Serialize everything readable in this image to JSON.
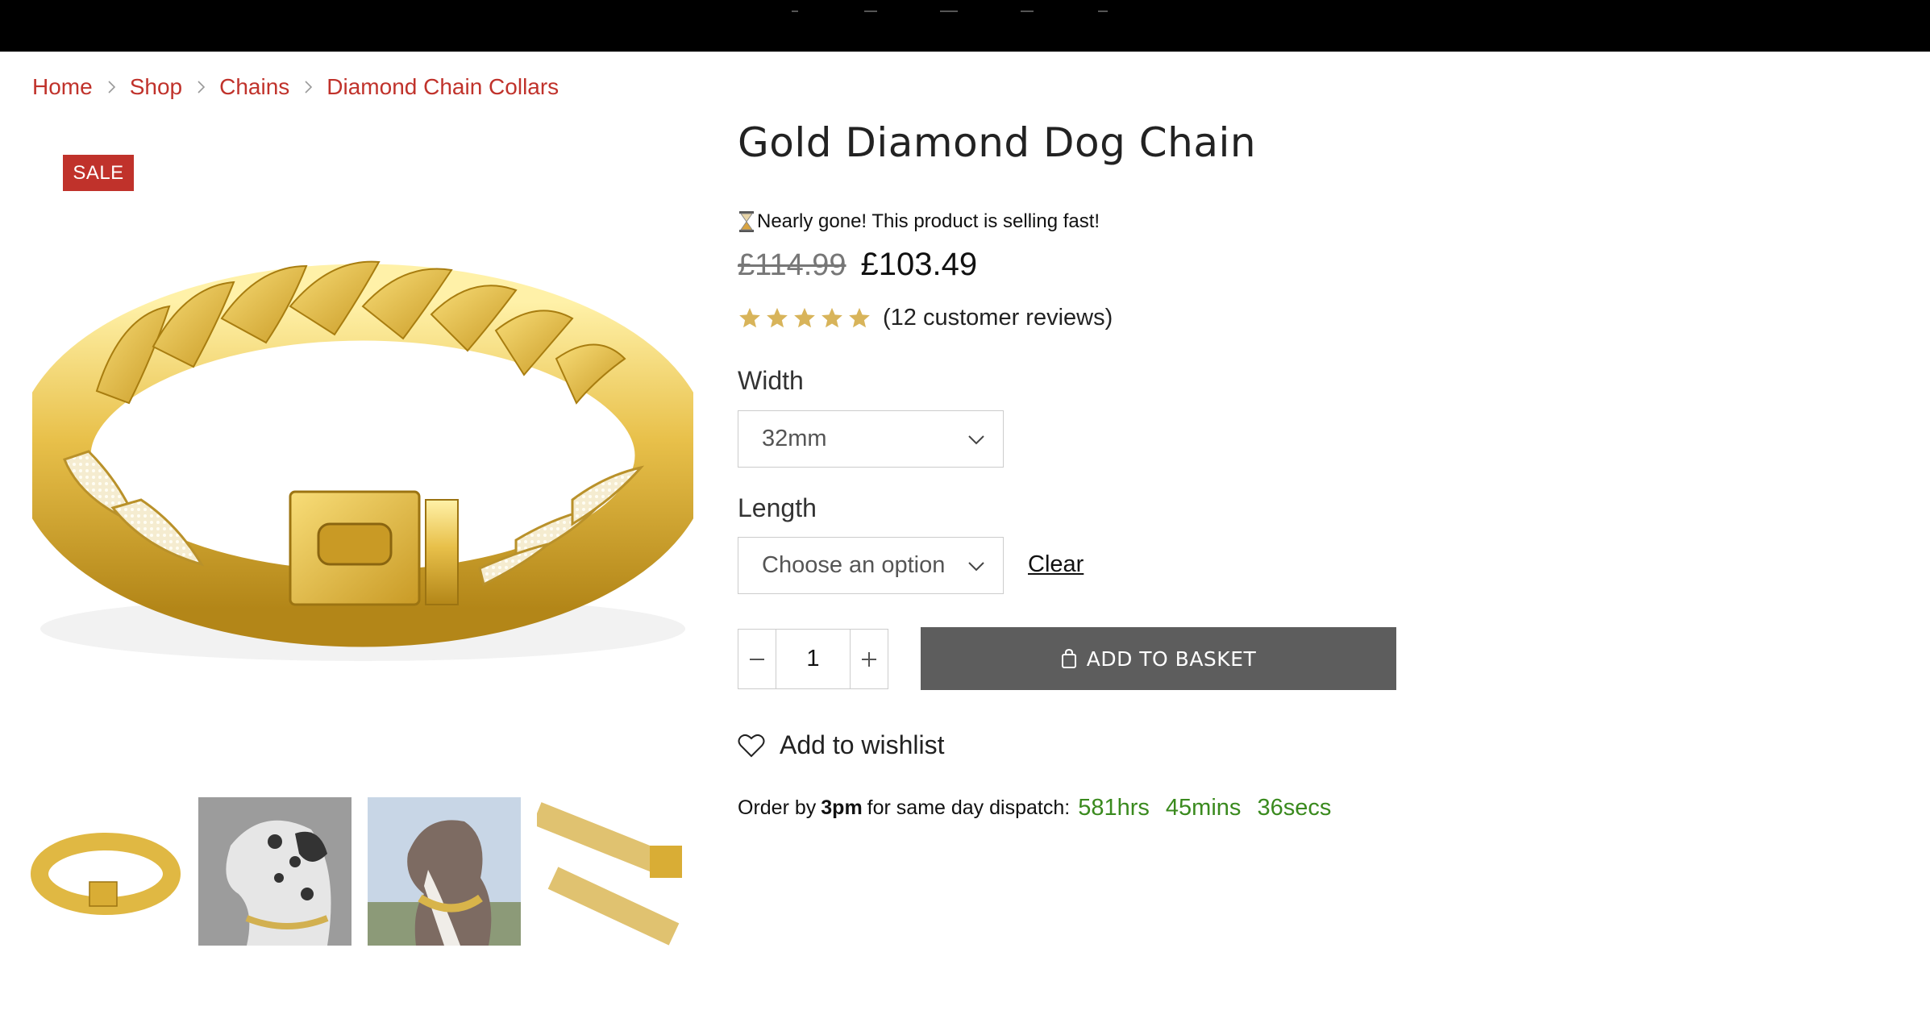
{
  "breadcrumb": {
    "items": [
      "Home",
      "Shop",
      "Chains",
      "Diamond Chain Collars"
    ]
  },
  "product": {
    "badge": "SALE",
    "title": "Gold Diamond Dog Chain",
    "urgency": "Nearly gone! This product is selling fast!",
    "price_old": "£114.99",
    "price_new": "£103.49",
    "rating": 5,
    "reviews_text": "(12 customer reviews)"
  },
  "options": {
    "width_label": "Width",
    "width_value": "32mm",
    "length_label": "Length",
    "length_value": "Choose an option",
    "clear_label": "Clear"
  },
  "cart": {
    "quantity": "1",
    "add_label": "ADD TO BASKET"
  },
  "wishlist": {
    "label": "Add to wishlist"
  },
  "dispatch": {
    "prefix": "Order by",
    "time": "3pm",
    "suffix": "for same day dispatch:",
    "hours": "581hrs",
    "mins": "45mins",
    "secs": "36secs"
  },
  "colors": {
    "accent": "#c0322b",
    "button": "#5d5d5d",
    "countdown": "#3a8a1e",
    "star": "#d8b45a"
  },
  "icons": [
    "chevron-right-icon",
    "hourglass-icon",
    "star-icon",
    "chevron-down-icon",
    "minus-icon",
    "plus-icon",
    "bag-icon",
    "heart-icon"
  ]
}
